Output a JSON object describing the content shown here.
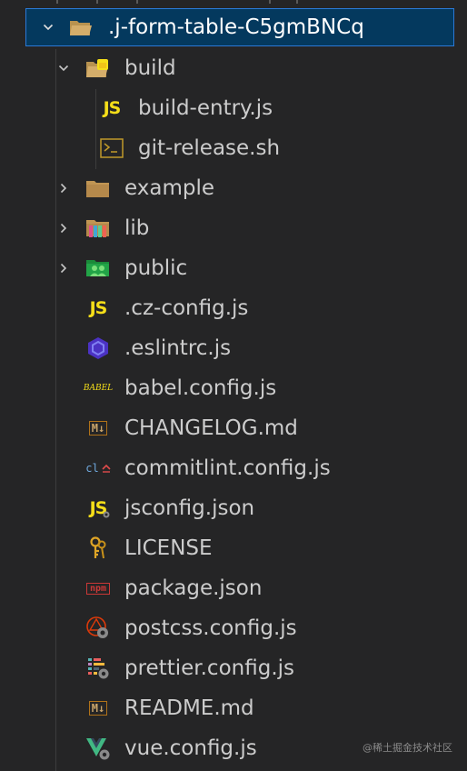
{
  "explorer": {
    "root": {
      "label": ".j-form-table-C5gmBNCq",
      "expanded": true,
      "icon": "folder-open-icon"
    },
    "items": [
      {
        "label": "build",
        "type": "folder",
        "expanded": true,
        "depth": 1,
        "icon": "folder-build-icon"
      },
      {
        "label": "build-entry.js",
        "type": "file",
        "depth": 2,
        "icon": "js-icon"
      },
      {
        "label": "git-release.sh",
        "type": "file",
        "depth": 2,
        "icon": "shell-icon"
      },
      {
        "label": "example",
        "type": "folder",
        "expanded": false,
        "depth": 1,
        "icon": "folder-icon"
      },
      {
        "label": "lib",
        "type": "folder",
        "expanded": false,
        "depth": 1,
        "icon": "folder-lib-icon"
      },
      {
        "label": "public",
        "type": "folder",
        "expanded": false,
        "depth": 1,
        "icon": "folder-public-icon"
      },
      {
        "label": ".cz-config.js",
        "type": "file",
        "depth": 1,
        "icon": "js-icon"
      },
      {
        "label": ".eslintrc.js",
        "type": "file",
        "depth": 1,
        "icon": "eslint-icon"
      },
      {
        "label": "babel.config.js",
        "type": "file",
        "depth": 1,
        "icon": "babel-icon"
      },
      {
        "label": "CHANGELOG.md",
        "type": "file",
        "depth": 1,
        "icon": "markdown-icon"
      },
      {
        "label": "commitlint.config.js",
        "type": "file",
        "depth": 1,
        "icon": "commitlint-icon"
      },
      {
        "label": "jsconfig.json",
        "type": "file",
        "depth": 1,
        "icon": "jsconfig-icon"
      },
      {
        "label": "LICENSE",
        "type": "file",
        "depth": 1,
        "icon": "license-key-icon"
      },
      {
        "label": "package.json",
        "type": "file",
        "depth": 1,
        "icon": "npm-icon"
      },
      {
        "label": "postcss.config.js",
        "type": "file",
        "depth": 1,
        "icon": "postcss-icon"
      },
      {
        "label": "prettier.config.js",
        "type": "file",
        "depth": 1,
        "icon": "prettier-icon"
      },
      {
        "label": "README.md",
        "type": "file",
        "depth": 1,
        "icon": "markdown-icon"
      },
      {
        "label": "vue.config.js",
        "type": "file",
        "depth": 1,
        "icon": "vue-icon"
      }
    ],
    "js_text": "JS",
    "shell_text": ">_",
    "babel_text": "BABEL",
    "md_text": "M↓",
    "cl_text": "cl",
    "npm_text": "npm"
  },
  "watermark": "@稀土掘金技术社区",
  "colors": {
    "selection_bg": "#04395e",
    "selection_border": "#2b79d6",
    "folder": "#c09553",
    "js": "#f5de19",
    "eslint": "#4b32c3",
    "markdown": "#b07219",
    "npm": "#cb3837",
    "vue": "#41b883"
  }
}
